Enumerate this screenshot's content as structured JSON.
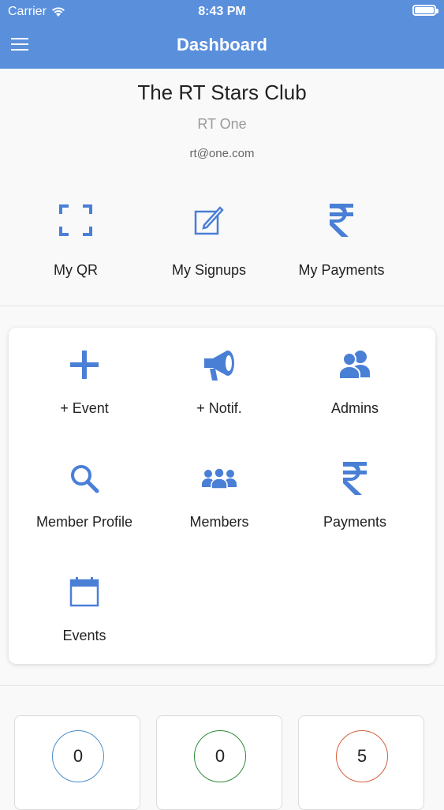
{
  "status_bar": {
    "carrier": "Carrier",
    "time": "8:43 PM"
  },
  "header": {
    "title": "Dashboard"
  },
  "profile": {
    "club_name": "The RT Stars Club",
    "user_name": "RT One",
    "email": "rt@one.com"
  },
  "quick_actions": [
    {
      "label": "My QR",
      "icon": "qr-scan-icon"
    },
    {
      "label": "My Signups",
      "icon": "edit-icon"
    },
    {
      "label": "My Payments",
      "icon": "rupee-icon"
    }
  ],
  "admin_actions": [
    {
      "label": "+ Event",
      "icon": "plus-icon"
    },
    {
      "label": "+ Notif.",
      "icon": "megaphone-icon"
    },
    {
      "label": "Admins",
      "icon": "users-icon"
    },
    {
      "label": "Member Profile",
      "icon": "search-icon"
    },
    {
      "label": "Members",
      "icon": "group-icon"
    },
    {
      "label": "Payments",
      "icon": "rupee-icon"
    },
    {
      "label": "Events",
      "icon": "calendar-icon"
    }
  ],
  "stats": [
    {
      "value": "0",
      "color": "#4a8cc9"
    },
    {
      "value": "0",
      "color": "#2e8b3a"
    },
    {
      "value": "5",
      "color": "#d2603e"
    }
  ],
  "colors": {
    "accent": "#5a8fdc",
    "icon": "#4a7fd6"
  }
}
